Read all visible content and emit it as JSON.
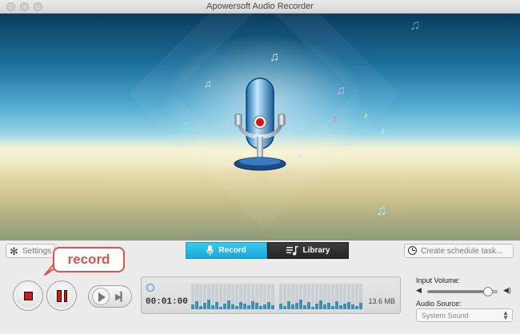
{
  "window": {
    "title": "Apowersoft Audio Recorder"
  },
  "toolbar": {
    "settings_label": "Settings",
    "tabs": [
      {
        "label": "Record",
        "active": true
      },
      {
        "label": "Library",
        "active": false
      }
    ],
    "schedule_label": "Create schedule task..."
  },
  "annotation": {
    "callout_text": "record"
  },
  "status": {
    "elapsed_time": "00:01:00",
    "file_size": "13.6 MB"
  },
  "audio": {
    "input_volume_label": "Input Volume:",
    "input_volume_level": 0.85,
    "source_label": "Audio Source:",
    "source_value": "System Sound"
  },
  "icons": {
    "settings": "gear-icon",
    "record_tab": "microphone-icon",
    "library_tab": "music-library-icon",
    "schedule": "clock-icon",
    "stop": "stop-icon",
    "pause": "pause-icon",
    "play": "play-icon",
    "next": "skip-next-icon",
    "volume_low": "speaker-low-icon",
    "volume_high": "speaker-high-icon"
  },
  "colors": {
    "record_tab": "#1ba7d6",
    "library_tab": "#262626",
    "stop_red": "#c41e1e",
    "callout_red": "#d9534f",
    "wave_blue": "#3f8fb3"
  }
}
